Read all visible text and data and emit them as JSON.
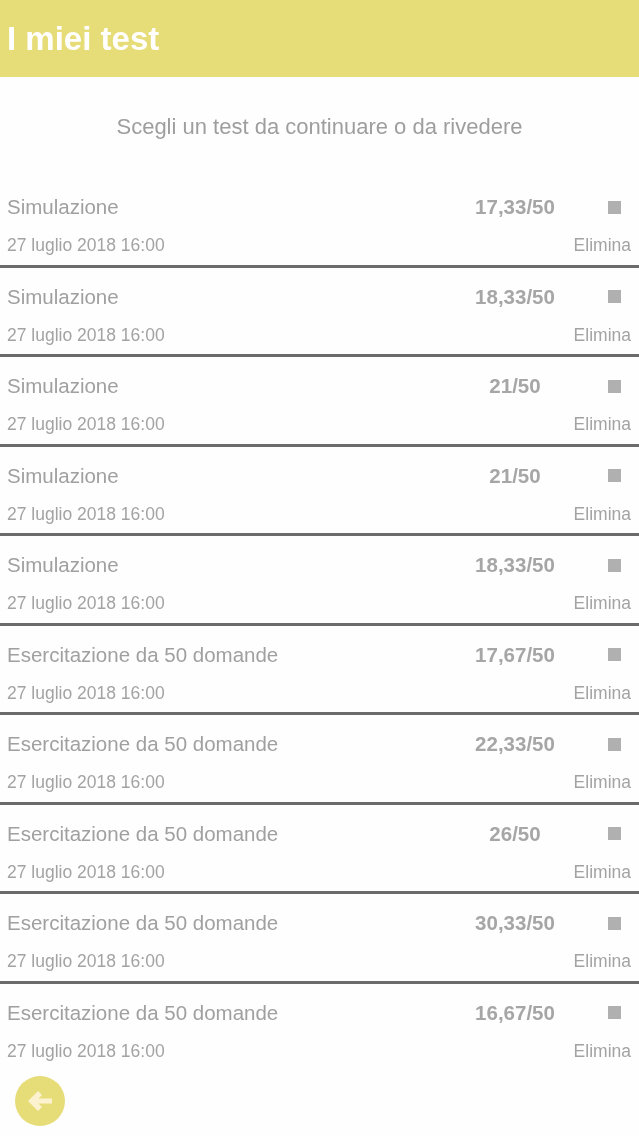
{
  "app_bar": {
    "title": "I miei test"
  },
  "subtitle": "Scegli un test da continuare o da rivedere",
  "tests": [
    {
      "name": "Simulazione",
      "score": "17,33/50",
      "date": "27 luglio 2018 16:00",
      "action": "Elimina"
    },
    {
      "name": "Simulazione",
      "score": "18,33/50",
      "date": "27 luglio 2018 16:00",
      "action": "Elimina"
    },
    {
      "name": "Simulazione",
      "score": "21/50",
      "date": "27 luglio 2018 16:00",
      "action": "Elimina"
    },
    {
      "name": "Simulazione",
      "score": "21/50",
      "date": "27 luglio 2018 16:00",
      "action": "Elimina"
    },
    {
      "name": "Simulazione",
      "score": "18,33/50",
      "date": "27 luglio 2018 16:00",
      "action": "Elimina"
    },
    {
      "name": "Esercitazione da 50 domande",
      "score": "17,67/50",
      "date": "27 luglio 2018 16:00",
      "action": "Elimina"
    },
    {
      "name": "Esercitazione da 50 domande",
      "score": "22,33/50",
      "date": "27 luglio 2018 16:00",
      "action": "Elimina"
    },
    {
      "name": "Esercitazione da 50 domande",
      "score": "26/50",
      "date": "27 luglio 2018 16:00",
      "action": "Elimina"
    },
    {
      "name": "Esercitazione da 50 domande",
      "score": "30,33/50",
      "date": "27 luglio 2018 16:00",
      "action": "Elimina"
    },
    {
      "name": "Esercitazione da 50 domande",
      "score": "16,67/50",
      "date": "27 luglio 2018 16:00",
      "action": "Elimina"
    }
  ]
}
